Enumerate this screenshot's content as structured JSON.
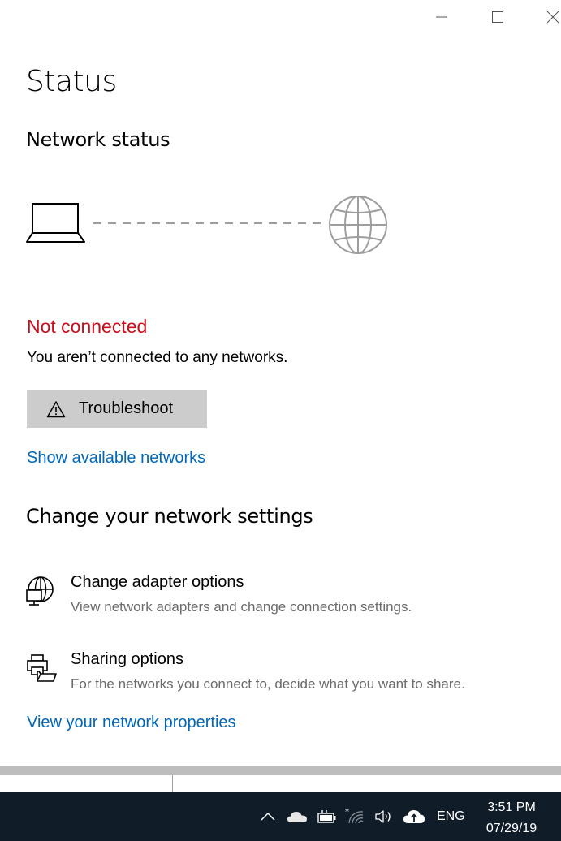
{
  "window": {
    "controls": [
      "minimize",
      "maximize",
      "close"
    ]
  },
  "page": {
    "title": "Status"
  },
  "network_status": {
    "heading": "Network status",
    "state": "Not connected",
    "description": "You aren’t connected to any networks.",
    "troubleshoot_label": "Troubleshoot",
    "show_networks_link": "Show available networks"
  },
  "change_settings": {
    "heading": "Change your network settings",
    "options": [
      {
        "icon": "network-adapter-icon",
        "title": "Change adapter options",
        "description": "View network adapters and change connection settings."
      },
      {
        "icon": "sharing-icon",
        "title": "Sharing options",
        "description": "For the networks you connect to, decide what you want to share."
      }
    ],
    "properties_link": "View your network properties"
  },
  "taskbar": {
    "tray_icons": [
      "chevron-up-icon",
      "onedrive-icon",
      "battery-icon",
      "wifi-icon",
      "volume-icon",
      "upload-icon"
    ],
    "language": "ENG",
    "time": "3:51 PM",
    "date": "07/29/19"
  },
  "colors": {
    "status_error": "#c50f1f",
    "link": "#0067b8",
    "button_bg": "#cccccc",
    "taskbar_bg": "#101c28"
  }
}
